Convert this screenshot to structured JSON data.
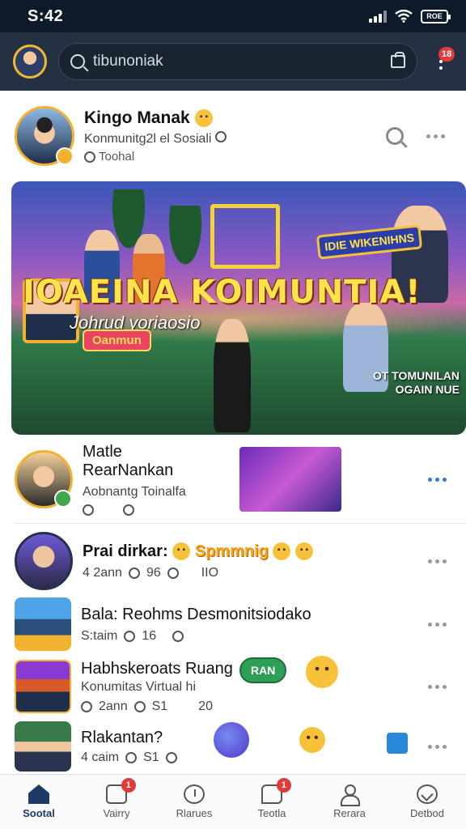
{
  "status": {
    "time": "S:42",
    "battery": "ROE"
  },
  "topbar": {
    "search_placeholder": "tibunoniak",
    "notifications_badge": "18"
  },
  "profile": {
    "name": "Kingo Manak",
    "subtitle": "Konmunitg2l el Sosiali",
    "meta": "Toohal"
  },
  "banner": {
    "headline": "IOAEINA KOIMUNTIA!",
    "subline": "Johrud yoriaosio",
    "pill": "Oanmun",
    "sign": "IDIE WIKENIHNS",
    "corner_line1": "OT TOMUNILAN",
    "corner_line2": "OGAIN NUE"
  },
  "posts": [
    {
      "title": "Matle RearNankan",
      "subtitle": "Aobnantg Toinalfa"
    },
    {
      "title": "Prai dirkar:",
      "highlight": "Spmmnig",
      "meta_time": "4 2ann",
      "meta_a": "96",
      "meta_b": "IIO"
    },
    {
      "title": "Bala: Reohms Desmonitsiodako",
      "meta_time": "S:taim",
      "meta_a": "16"
    },
    {
      "title": "Habhskeroats Ruang",
      "subtitle": "Konumitas Virtual hi",
      "meta_time": "2ann",
      "meta_a": "S1",
      "meta_b": "20",
      "bubble": "RAN"
    },
    {
      "title": "Rlakantan?",
      "meta_time": "4 caim",
      "meta_a": "S1"
    }
  ],
  "nav": [
    {
      "label": "Sootal",
      "icon": "home-icon"
    },
    {
      "label": "Vairry",
      "icon": "inbox-icon",
      "badge": "1"
    },
    {
      "label": "Rlarues",
      "icon": "clock-icon"
    },
    {
      "label": "Teotla",
      "icon": "chat-icon",
      "badge": "1"
    },
    {
      "label": "Rerara",
      "icon": "user-icon"
    },
    {
      "label": "Detbod",
      "icon": "globe-icon"
    }
  ]
}
